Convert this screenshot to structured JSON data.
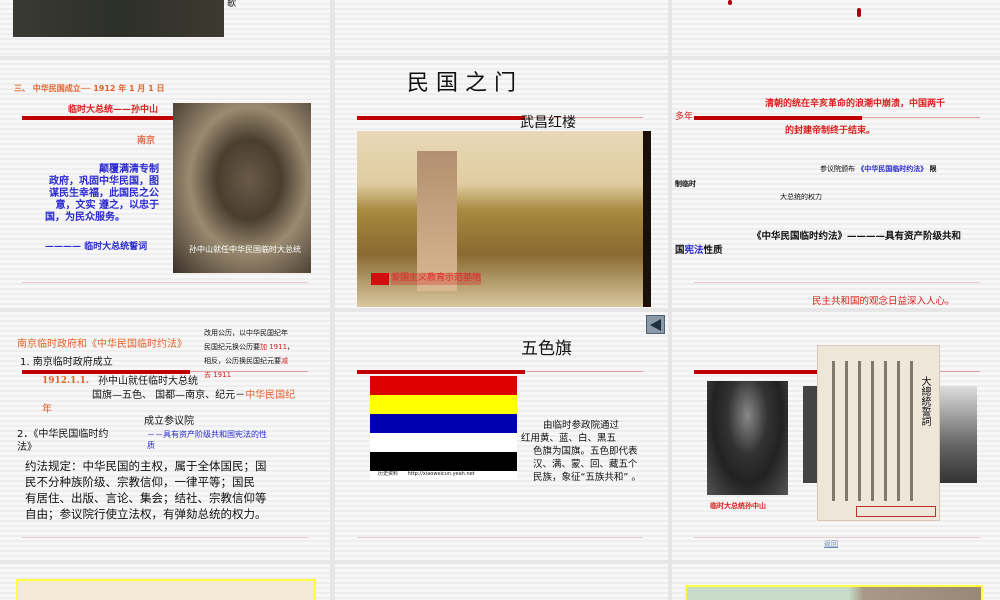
{
  "row1": {
    "slide1_fragment": "歌"
  },
  "slide4": {
    "heading": "三、    中华民国成立── 1912 年 1  月 1 日",
    "subtitle": "临时大总统——孙中山",
    "place": "南京",
    "oath_lines": [
      "颠覆满清专制",
      "政府，巩固中华民国，图",
      "谋民生幸福，此国民之公",
      "意，文实  遵之，以忠于",
      "国，为民众服务。"
    ],
    "oath_source": "———— 临时大总统誓词",
    "photo_caption": "孙中山就任中华民国临时大总统"
  },
  "slide5": {
    "title": "民 国 之 门",
    "subtitle": "武昌红楼",
    "photo_caption": "爱国主义教育示范基地"
  },
  "slide6": {
    "line1": "清朝的统在辛亥革命的浪潮中崩溃，中国两千",
    "line1b": "多年",
    "line2": "的封建帝制终于结束。",
    "line3a": "参议院颁布",
    "line3b": "《中华民国临时约法》",
    "line3c": "限",
    "line4": "制临时",
    "line5": "大总统的权力",
    "line6": "《中华民国临时约法》————具有资产阶级共和",
    "line7a": "国",
    "line7b": "宪法",
    "line7c": "性质",
    "line8": "民主共和国的观念日益深入人心。"
  },
  "slide7": {
    "title": "南京临时政府和《中华民国临时约法》",
    "note1": "改用公历，以中华民国纪年",
    "note2a": "民国纪元换公历要",
    "note2b": "加 1911",
    "note2c": "，",
    "note3a": "相反，公历换民国纪元要",
    "note3b": "减",
    "note4": "去 1911",
    "item1": "1. 南京临时政府成立",
    "date": "1912.1.1.",
    "event": "孙中山就任临时大总统",
    "flag_capital": "国旗—五色、  国都—南京、纪元－",
    "era": "中华民国纪",
    "era2": "年",
    "senate": "成立参议院",
    "item2a": "2．《中华民国临时约",
    "item2b": "法》",
    "nature1": "－－具有资产阶级共和国宪法的性",
    "nature2": "质",
    "body": [
      "约法规定：中华民国的主权，属于全体国民；国",
      "民不分种族阶级、宗教信仰，一律平等；国民",
      "有居住、出版、言论、集会；结社、宗教信仰等",
      "自由；参议院行使立法权，有弹劾总统的权力。"
    ]
  },
  "slide8": {
    "title": "五色旗",
    "flag_colors": [
      "#dd0000",
      "#ffff00",
      "#0000b0",
      "#ffffff",
      "#000000"
    ],
    "flag_credit_a": "历史资料",
    "flag_credit_b": "http://xiaoweicun.yeah.net",
    "desc": [
      "由临时参政院通过",
      "红用黄、蓝、白、黑五",
      "色旗为国旗。五色即代表",
      "汉、满、蒙、回、藏五个",
      "民族，象征“五族共和”  。"
    ],
    "back_icon": "triangle-left-icon"
  },
  "slide9": {
    "caption": "临时大总统孙中山",
    "calligraphy_title": "大總統誓詞",
    "back_link": "返回"
  },
  "colors": {
    "accent_red": "#c00000",
    "text_blue": "#2a2ad0",
    "text_orange": "#e4622a"
  }
}
